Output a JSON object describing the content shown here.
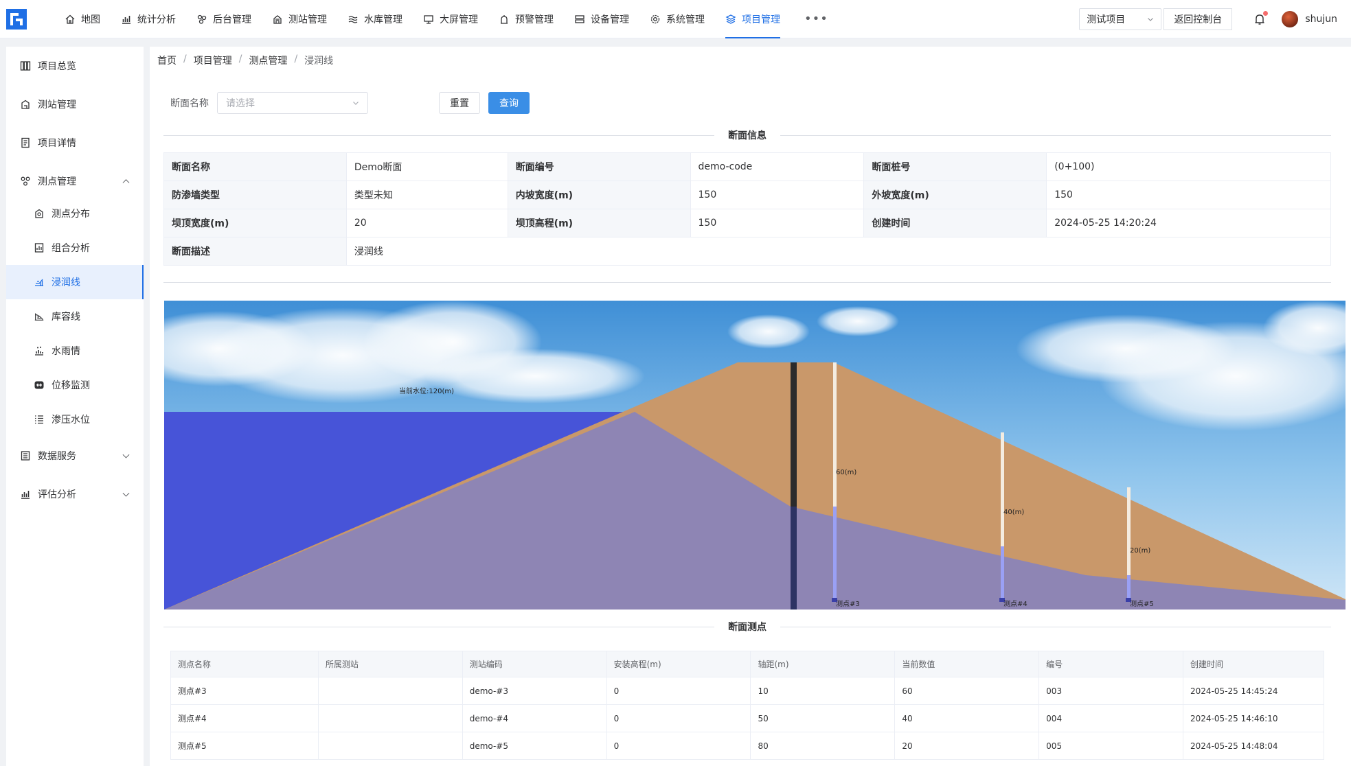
{
  "topnav": {
    "items": [
      {
        "label": "地图",
        "icon": "home-icon"
      },
      {
        "label": "统计分析",
        "icon": "chart-icon"
      },
      {
        "label": "后台管理",
        "icon": "cluster-icon"
      },
      {
        "label": "测站管理",
        "icon": "station-icon"
      },
      {
        "label": "水库管理",
        "icon": "reservoir-icon"
      },
      {
        "label": "大屏管理",
        "icon": "monitor-icon"
      },
      {
        "label": "预警管理",
        "icon": "alarm-icon"
      },
      {
        "label": "设备管理",
        "icon": "device-icon"
      },
      {
        "label": "系统管理",
        "icon": "gear-icon"
      },
      {
        "label": "项目管理",
        "icon": "layers-icon"
      }
    ],
    "more": "•••",
    "project_select": "测试项目",
    "back_label": "返回控制台",
    "username": "shujun",
    "accent": "#1f6fe5"
  },
  "sidebar": {
    "items": [
      {
        "label": "项目总览"
      },
      {
        "label": "测站管理"
      },
      {
        "label": "项目详情"
      },
      {
        "label": "测点管理"
      }
    ],
    "sub_items": [
      {
        "label": "测点分布"
      },
      {
        "label": "组合分析"
      },
      {
        "label": "浸润线"
      },
      {
        "label": "库容线"
      },
      {
        "label": "水雨情"
      },
      {
        "label": "位移监测"
      },
      {
        "label": "渗压水位"
      }
    ],
    "bottom_items": [
      {
        "label": "数据服务"
      },
      {
        "label": "评估分析"
      }
    ]
  },
  "breadcrumb": [
    "首页",
    "项目管理",
    "测点管理",
    "浸润线"
  ],
  "filter": {
    "label": "断面名称",
    "placeholder": "请选择",
    "reset": "重置",
    "query": "查询"
  },
  "section_info_title": "断面信息",
  "section_points_title": "断面测点",
  "info": {
    "name_label": "断面名称",
    "name": "Demo断面",
    "code_label": "断面编号",
    "code": "demo-code",
    "pile_label": "断面桩号",
    "pile": "(0+100)",
    "wall_label": "防渗墙类型",
    "wall": "类型未知",
    "inner_label": "内坡宽度(m)",
    "inner": "150",
    "outer_label": "外坡宽度(m)",
    "outer": "150",
    "top_w_label": "坝顶宽度(m)",
    "top_w": "20",
    "top_h_label": "坝顶高程(m)",
    "top_h": "150",
    "created_label": "创建时间",
    "created": "2024-05-25 14:20:24",
    "desc_label": "断面描述",
    "desc": "浸润线"
  },
  "scene": {
    "water_label": "当前水位:120(m)",
    "wells": [
      {
        "name": "测点#3",
        "value_label": "60(m)"
      },
      {
        "name": "测点#4",
        "value_label": "40(m)"
      },
      {
        "name": "测点#5",
        "value_label": "20(m)"
      }
    ]
  },
  "points_table": {
    "headers": [
      "测点名称",
      "所属测站",
      "测站编码",
      "安装高程(m)",
      "轴距(m)",
      "当前数值",
      "编号",
      "创建时间"
    ],
    "rows": [
      [
        "测点#3",
        "",
        "demo-#3",
        "0",
        "10",
        "60",
        "003",
        "2024-05-25 14:45:24"
      ],
      [
        "测点#4",
        "",
        "demo-#4",
        "0",
        "50",
        "40",
        "004",
        "2024-05-25 14:46:10"
      ],
      [
        "测点#5",
        "",
        "demo-#5",
        "0",
        "80",
        "20",
        "005",
        "2024-05-25 14:48:04"
      ]
    ]
  }
}
